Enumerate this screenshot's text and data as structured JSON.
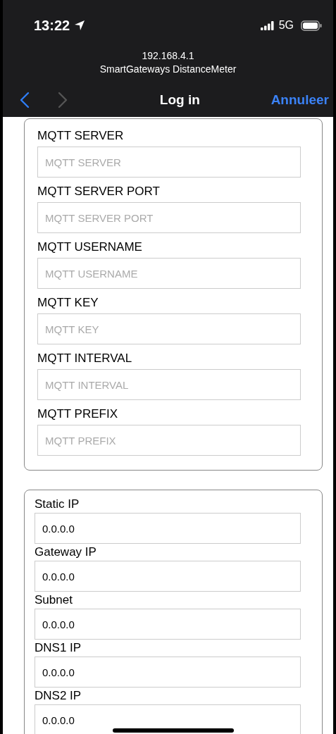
{
  "status_bar": {
    "time": "13:22",
    "network": "5G"
  },
  "browser": {
    "host": "192.168.4.1",
    "page_title": "SmartGateways DistanceMeter"
  },
  "nav": {
    "title": "Log in",
    "cancel": "Annuleer",
    "back_enabled": true,
    "forward_enabled": false
  },
  "mqtt_section": {
    "fields": [
      {
        "label": "MQTT SERVER",
        "placeholder": "MQTT SERVER"
      },
      {
        "label": "MQTT SERVER PORT",
        "placeholder": "MQTT SERVER PORT"
      },
      {
        "label": "MQTT USERNAME",
        "placeholder": "MQTT USERNAME"
      },
      {
        "label": "MQTT KEY",
        "placeholder": "MQTT KEY"
      },
      {
        "label": "MQTT INTERVAL",
        "placeholder": "MQTT INTERVAL"
      },
      {
        "label": "MQTT PREFIX",
        "placeholder": "MQTT PREFIX"
      }
    ]
  },
  "network_section": {
    "fields": [
      {
        "label": "Static IP",
        "value": "0.0.0.0"
      },
      {
        "label": "Gateway IP",
        "value": "0.0.0.0"
      },
      {
        "label": "Subnet",
        "value": "0.0.0.0"
      },
      {
        "label": "DNS1 IP",
        "value": "0.0.0.0"
      },
      {
        "label": "DNS2 IP",
        "value": "0.0.0.0"
      }
    ]
  }
}
